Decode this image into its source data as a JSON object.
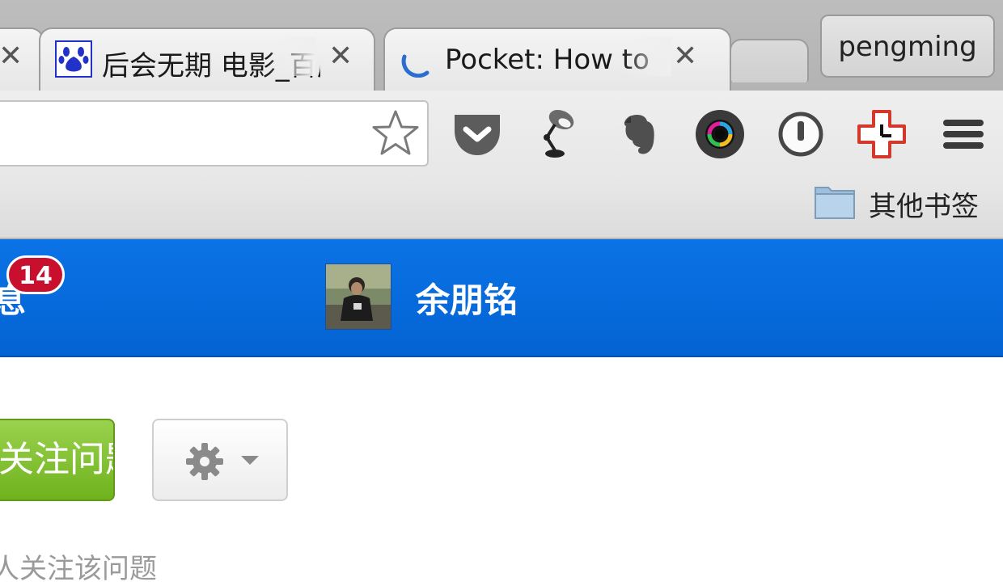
{
  "browser": {
    "tabs": [
      {
        "title": "",
        "close": "✕"
      },
      {
        "title": "后会无期 电影_百度",
        "close": "✕",
        "favicon": "baidu-paw-icon"
      },
      {
        "title": "Pocket: How to",
        "close": "✕",
        "favicon": "pocket-loading-icon"
      }
    ],
    "profile": "pengming",
    "toolbar_icons": [
      "bookmark-star-icon",
      "pocket-icon",
      "lamp-icon",
      "evernote-icon",
      "camera-lens-icon",
      "1password-icon",
      "timer-cross-icon",
      "menu-icon"
    ],
    "bookmarks": {
      "folder_label": "其他书签"
    }
  },
  "site": {
    "nav_partial": "息",
    "notification_count": "14",
    "username": "余朋铭",
    "brand_color": "#0767d8"
  },
  "content": {
    "follow_button": "关注问题",
    "settings_button": "gear-icon",
    "follow_count_text": "人关注该问题"
  }
}
